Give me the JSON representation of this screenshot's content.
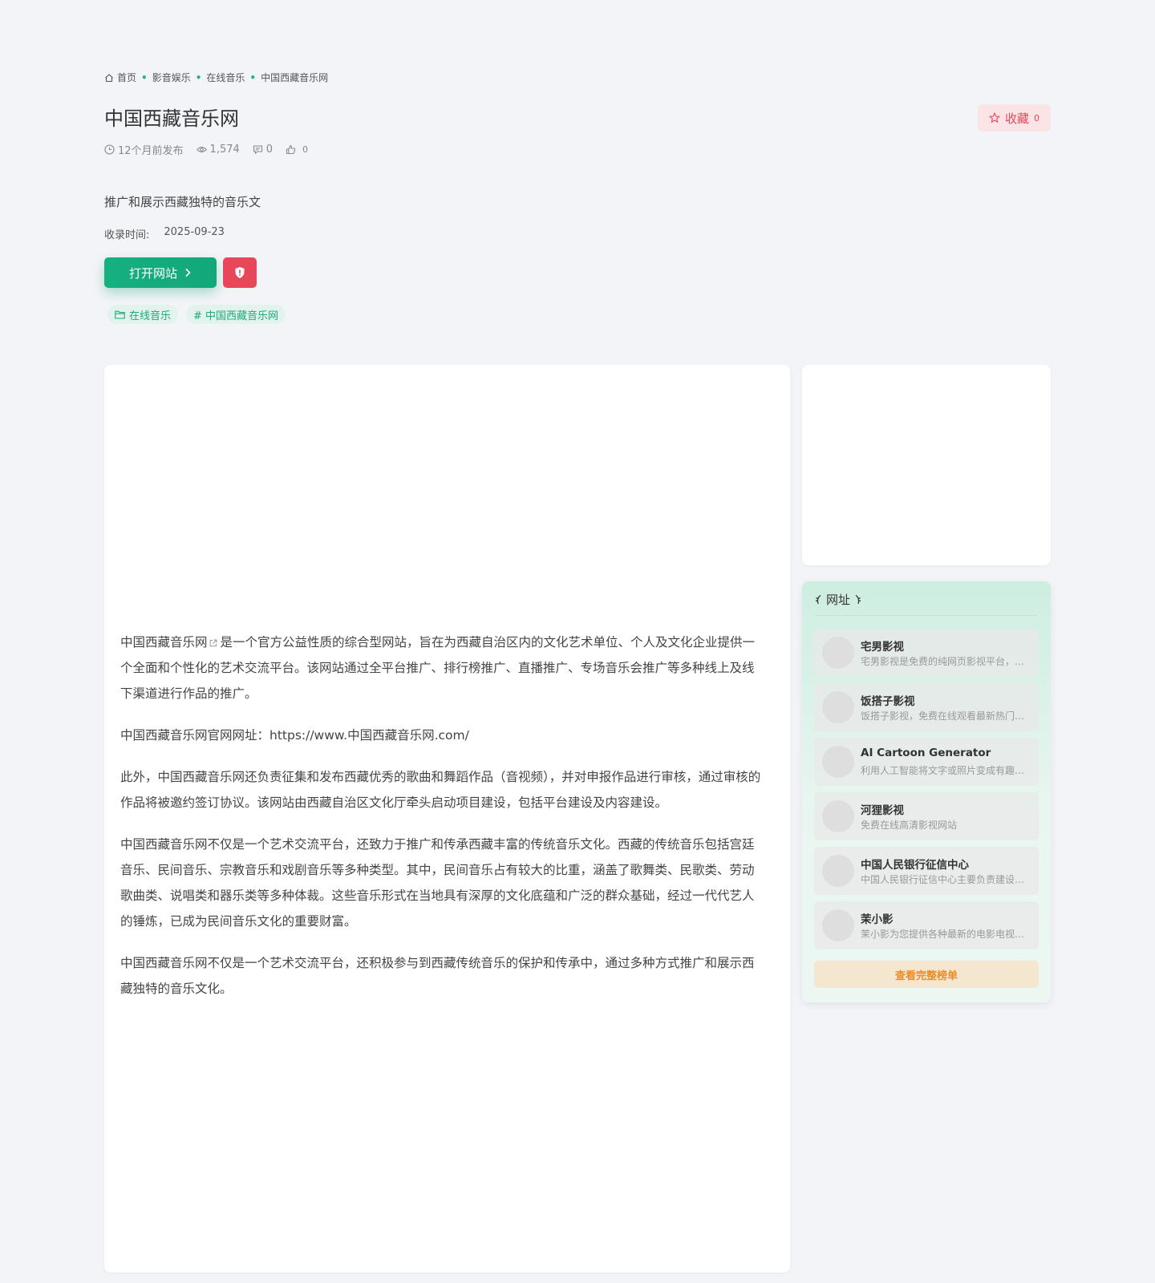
{
  "breadcrumb": {
    "items": [
      "首页",
      "影音娱乐",
      "在线音乐",
      "中国西藏音乐网"
    ]
  },
  "site": {
    "title": "中国西藏音乐网",
    "description": "推广和展示西藏独特的音乐文",
    "record_label": "收录时间:",
    "record_date": "2025-09-23"
  },
  "meta": {
    "published": "12个月前发布",
    "views": "1,574",
    "comments": "0",
    "likes": "0"
  },
  "favorite": {
    "label": "收藏",
    "count": "0"
  },
  "actions": {
    "open_label": "打开网站"
  },
  "tags": {
    "category": "在线音乐",
    "keyword": "# 中国西藏音乐网"
  },
  "article": {
    "p1_link": "中国西藏音乐网",
    "p1_rest": "是一个官方公益性质的综合型网站，旨在为西藏自治区内的文化艺术单位、个人及文化企业提供一个全面和个性化的艺术交流平台。该网站通过全平台推广、排行榜推广、直播推广、专场音乐会推广等多种线上及线下渠道进行作品的推广。",
    "p2": "中国西藏音乐网官网网址：https://www.中国西藏音乐网.com/",
    "p3": "此外，中国西藏音乐网还负责征集和发布西藏优秀的歌曲和舞蹈作品（音视频），并对申报作品进行审核，通过审核的作品将被邀约签订协议。该网站由西藏自治区文化厅牵头启动项目建设，包括平台建设及内容建设。",
    "p4": "中国西藏音乐网不仅是一个艺术交流平台，还致力于推广和传承西藏丰富的传统音乐文化。西藏的传统音乐包括宫廷音乐、民间音乐、宗教音乐和戏剧音乐等多种类型。其中，民间音乐占有较大的比重，涵盖了歌舞类、民歌类、劳动歌曲类、说唱类和器乐类等多种体裁。这些音乐形式在当地具有深厚的文化底蕴和广泛的群众基础，经过一代代艺人的锤炼，已成为民间音乐文化的重要财富。",
    "p5": "中国西藏音乐网不仅是一个艺术交流平台，还积极参与到西藏传统音乐的保护和传承中，通过多种方式推广和展示西藏独特的音乐文化。"
  },
  "sidebar": {
    "header": "网址",
    "items": [
      {
        "name": "宅男影视",
        "desc": "宅男影视是免费的纯网页影视平台，提供海量影视资源在线观看"
      },
      {
        "name": "饭搭子影视",
        "desc": "饭搭子影视，免费在线观看最新热门影视剧集"
      },
      {
        "name": "AI Cartoon Generator",
        "desc": "利用人工智能将文字或照片变成有趣的卡通图片"
      },
      {
        "name": "河狸影视",
        "desc": "免费在线高清影视网站"
      },
      {
        "name": "中国人民银行征信中心",
        "desc": "中国人民银行征信中心主要负责建设、运行和维护全国统一的征信系统"
      },
      {
        "name": "茉小影",
        "desc": "茉小影为您提供各种最新的电影电视剧在线观看"
      }
    ],
    "more_label": "查看完整榜单"
  },
  "colors": {
    "accent": "#13a779",
    "danger": "#e8475a",
    "background": "#f3f4f7"
  }
}
